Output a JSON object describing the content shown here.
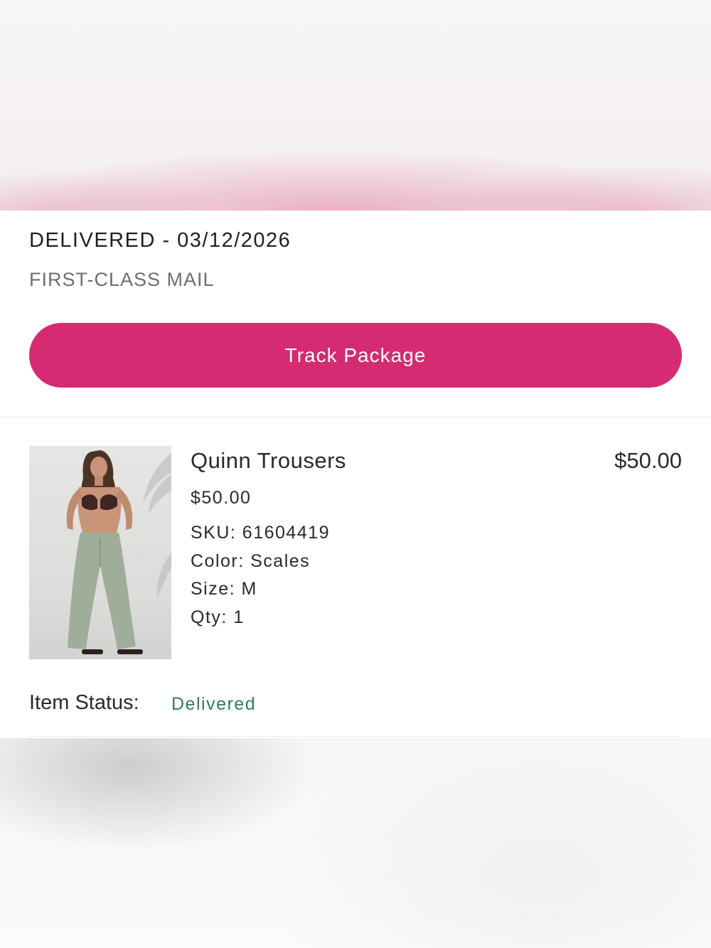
{
  "shipment": {
    "status_line": "DELIVERED - 03/12/2026",
    "method": "FIRST-CLASS MAIL",
    "track_button_label": "Track Package"
  },
  "item": {
    "image_icon": "product-photo",
    "name": "Quinn Trousers",
    "line_total": "$50.00",
    "unit_price": "$50.00",
    "sku": "SKU: 61604419",
    "color": "Color: Scales",
    "size": "Size: M",
    "qty": "Qty: 1"
  },
  "item_status": {
    "label": "Item Status:",
    "value": "Delivered"
  },
  "colors": {
    "accent": "#d42b72",
    "status_delivered": "#2f7a5f"
  }
}
